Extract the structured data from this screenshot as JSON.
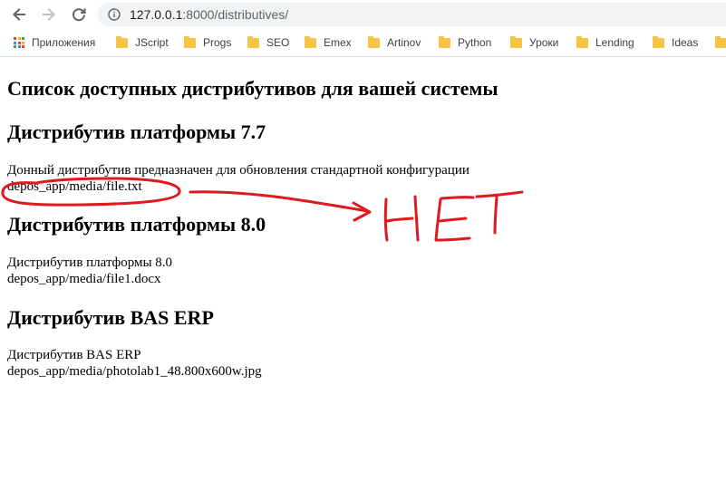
{
  "browser": {
    "url_host": "127.0.0.1",
    "url_path": ":8000/distributives/",
    "bookmarks": [
      {
        "label": "Приложения",
        "icon": "apps-icon"
      },
      {
        "label": "JScript",
        "icon": "folder-icon"
      },
      {
        "label": "Progs",
        "icon": "folder-icon"
      },
      {
        "label": "SEO",
        "icon": "folder-icon"
      },
      {
        "label": "Emex",
        "icon": "folder-icon"
      },
      {
        "label": "Artinov",
        "icon": "folder-icon"
      },
      {
        "label": "Python",
        "icon": "folder-icon"
      },
      {
        "label": "Уроки",
        "icon": "folder-icon"
      },
      {
        "label": "Lending",
        "icon": "folder-icon"
      },
      {
        "label": "Ideas",
        "icon": "folder-icon"
      }
    ],
    "colors": {
      "folder": "#f6c445",
      "omnibox": "#f1f3f4",
      "apps_grid": [
        "#ea4335",
        "#fbbc05",
        "#34a853",
        "#4285f4"
      ]
    }
  },
  "page": {
    "title": "Список доступных дистрибутивов для вашей системы",
    "items": [
      {
        "heading": "Дистрибутив платформы 7.7",
        "description": "Донный дистрибутив предназначен для обновления стандартной конфигурации",
        "file": "depos_app/media/file.txt"
      },
      {
        "heading": "Дистрибутив платформы 8.0",
        "description": "Дистрибутив платформы 8.0",
        "file": "depos_app/media/file1.docx"
      },
      {
        "heading": "Дистрибутив BAS ERP",
        "description": "Дистрибутив BAS ERP",
        "file": "depos_app/media/photolab1_48.800x600w.jpg"
      }
    ]
  },
  "annotation": {
    "text": "НЕТ",
    "color": "#e0191f"
  }
}
